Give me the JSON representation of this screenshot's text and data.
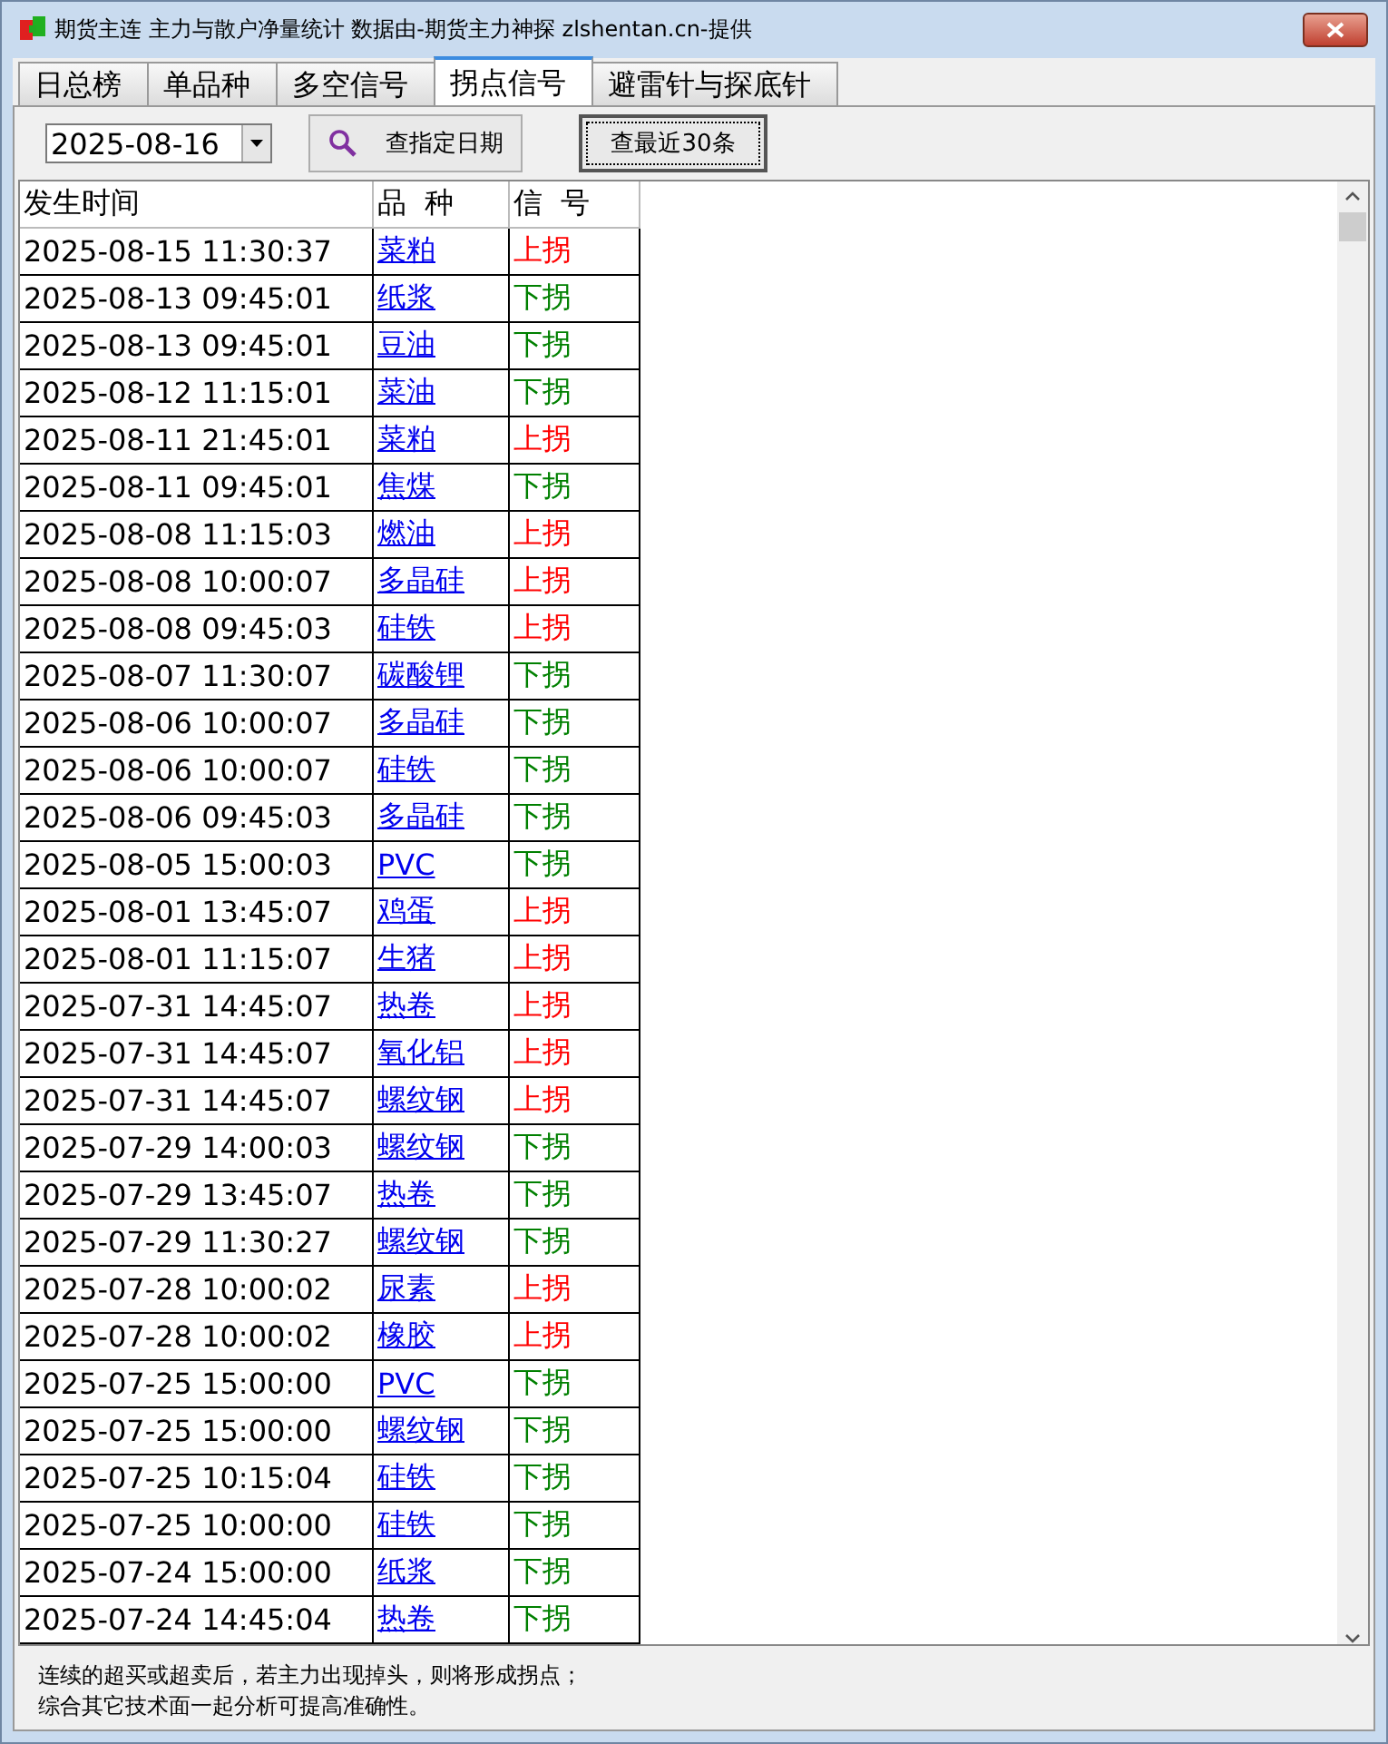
{
  "window": {
    "title": "期货主连 主力与散户净量统计 数据由-期货主力神探 zlshentan.cn-提供"
  },
  "tabs": [
    {
      "label": "日总榜",
      "selected": false
    },
    {
      "label": "单品种",
      "selected": false
    },
    {
      "label": "多空信号",
      "selected": false
    },
    {
      "label": "拐点信号",
      "selected": true
    },
    {
      "label": "避雷针与探底针",
      "selected": false
    }
  ],
  "toolbar": {
    "date": "2025-08-16",
    "query_button": "查指定日期",
    "recent_button": "查最近30条"
  },
  "table": {
    "columns": [
      "发生时间",
      "品  种",
      "信  号"
    ],
    "rows": [
      {
        "time": "2025-08-15 11:30:37",
        "variety": "菜粕",
        "signal": "上拐",
        "kind": "up"
      },
      {
        "time": "2025-08-13 09:45:01",
        "variety": "纸浆",
        "signal": "下拐",
        "kind": "down"
      },
      {
        "time": "2025-08-13 09:45:01",
        "variety": "豆油",
        "signal": "下拐",
        "kind": "down"
      },
      {
        "time": "2025-08-12 11:15:01",
        "variety": "菜油",
        "signal": "下拐",
        "kind": "down"
      },
      {
        "time": "2025-08-11 21:45:01",
        "variety": "菜粕",
        "signal": "上拐",
        "kind": "up"
      },
      {
        "time": "2025-08-11 09:45:01",
        "variety": "焦煤",
        "signal": "下拐",
        "kind": "down"
      },
      {
        "time": "2025-08-08 11:15:03",
        "variety": "燃油",
        "signal": "上拐",
        "kind": "up"
      },
      {
        "time": "2025-08-08 10:00:07",
        "variety": "多晶硅",
        "signal": "上拐",
        "kind": "up"
      },
      {
        "time": "2025-08-08 09:45:03",
        "variety": "硅铁",
        "signal": "上拐",
        "kind": "up"
      },
      {
        "time": "2025-08-07 11:30:07",
        "variety": "碳酸锂",
        "signal": "下拐",
        "kind": "down"
      },
      {
        "time": "2025-08-06 10:00:07",
        "variety": "多晶硅",
        "signal": "下拐",
        "kind": "down"
      },
      {
        "time": "2025-08-06 10:00:07",
        "variety": "硅铁",
        "signal": "下拐",
        "kind": "down"
      },
      {
        "time": "2025-08-06 09:45:03",
        "variety": "多晶硅",
        "signal": "下拐",
        "kind": "down"
      },
      {
        "time": "2025-08-05 15:00:03",
        "variety": "PVC",
        "signal": "下拐",
        "kind": "down"
      },
      {
        "time": "2025-08-01 13:45:07",
        "variety": "鸡蛋",
        "signal": "上拐",
        "kind": "up"
      },
      {
        "time": "2025-08-01 11:15:07",
        "variety": "生猪",
        "signal": "上拐",
        "kind": "up"
      },
      {
        "time": "2025-07-31 14:45:07",
        "variety": "热卷",
        "signal": "上拐",
        "kind": "up"
      },
      {
        "time": "2025-07-31 14:45:07",
        "variety": "氧化铝",
        "signal": "上拐",
        "kind": "up"
      },
      {
        "time": "2025-07-31 14:45:07",
        "variety": "螺纹钢",
        "signal": "上拐",
        "kind": "up"
      },
      {
        "time": "2025-07-29 14:00:03",
        "variety": "螺纹钢",
        "signal": "下拐",
        "kind": "down"
      },
      {
        "time": "2025-07-29 13:45:07",
        "variety": "热卷",
        "signal": "下拐",
        "kind": "down"
      },
      {
        "time": "2025-07-29 11:30:27",
        "variety": "螺纹钢",
        "signal": "下拐",
        "kind": "down"
      },
      {
        "time": "2025-07-28 10:00:02",
        "variety": "尿素",
        "signal": "上拐",
        "kind": "up"
      },
      {
        "time": "2025-07-28 10:00:02",
        "variety": "橡胶",
        "signal": "上拐",
        "kind": "up"
      },
      {
        "time": "2025-07-25 15:00:00",
        "variety": "PVC",
        "signal": "下拐",
        "kind": "down"
      },
      {
        "time": "2025-07-25 15:00:00",
        "variety": "螺纹钢",
        "signal": "下拐",
        "kind": "down"
      },
      {
        "time": "2025-07-25 10:15:04",
        "variety": "硅铁",
        "signal": "下拐",
        "kind": "down"
      },
      {
        "time": "2025-07-25 10:00:00",
        "variety": "硅铁",
        "signal": "下拐",
        "kind": "down"
      },
      {
        "time": "2025-07-24 15:00:00",
        "variety": "纸浆",
        "signal": "下拐",
        "kind": "down"
      },
      {
        "time": "2025-07-24 14:45:04",
        "variety": "热卷",
        "signal": "下拐",
        "kind": "down"
      }
    ]
  },
  "footer": [
    "连续的超买或超卖后，若主力出现掉头，则将形成拐点；",
    "综合其它技术面一起分析可提高准确性。"
  ]
}
